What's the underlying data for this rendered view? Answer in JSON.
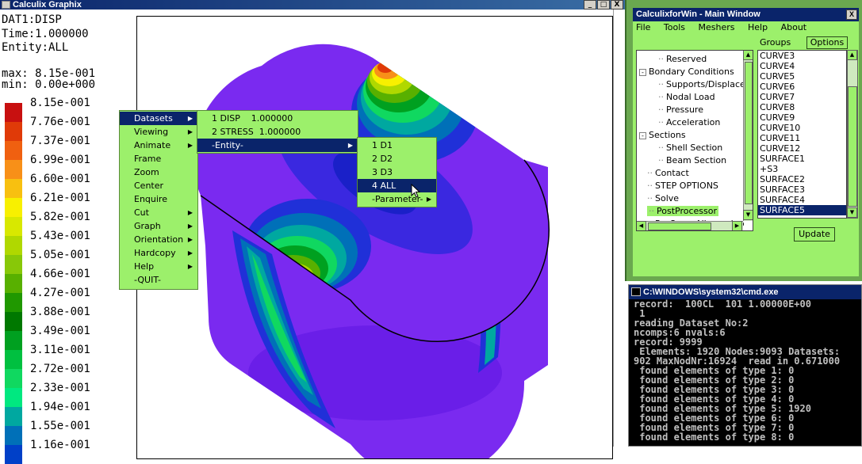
{
  "graphix": {
    "title": "Calculix Graphix",
    "window_buttons": [
      "_",
      "□",
      "X"
    ],
    "info_lines": [
      "DAT1:DISP",
      "Time:1.000000",
      "Entity:ALL"
    ],
    "max_label": "max: 8.15e-001",
    "min_label": "min: 0.00e+000",
    "legend": [
      {
        "label": "8.15e-001",
        "color": "#c81010"
      },
      {
        "label": "7.76e-001",
        "color": "#e03a08"
      },
      {
        "label": "7.37e-001",
        "color": "#f06010"
      },
      {
        "label": "6.99e-001",
        "color": "#f89018"
      },
      {
        "label": "6.60e-001",
        "color": "#f8c010"
      },
      {
        "label": "6.21e-001",
        "color": "#f8f000"
      },
      {
        "label": "5.82e-001",
        "color": "#d8e800"
      },
      {
        "label": "5.43e-001",
        "color": "#b0d800"
      },
      {
        "label": "5.05e-001",
        "color": "#88c808"
      },
      {
        "label": "4.66e-001",
        "color": "#58b000"
      },
      {
        "label": "4.27e-001",
        "color": "#209800"
      },
      {
        "label": "3.88e-001",
        "color": "#007800"
      },
      {
        "label": "3.49e-001",
        "color": "#00a020"
      },
      {
        "label": "3.11e-001",
        "color": "#00c040"
      },
      {
        "label": "2.72e-001",
        "color": "#10d860"
      },
      {
        "label": "2.33e-001",
        "color": "#00e880"
      },
      {
        "label": "1.94e-001",
        "color": "#00a8a0"
      },
      {
        "label": "1.55e-001",
        "color": "#0070b8"
      },
      {
        "label": "1.16e-001",
        "color": "#0040c8"
      }
    ]
  },
  "menus": {
    "main": [
      {
        "label": "Datasets",
        "submenu": true,
        "selected": true
      },
      {
        "label": "Viewing",
        "submenu": true
      },
      {
        "label": "Animate",
        "submenu": true
      },
      {
        "label": "Frame"
      },
      {
        "label": "Zoom"
      },
      {
        "label": "Center"
      },
      {
        "label": "Enquire"
      },
      {
        "label": "Cut",
        "submenu": true
      },
      {
        "label": "Graph",
        "submenu": true
      },
      {
        "label": "Orientation",
        "submenu": true
      },
      {
        "label": "Hardcopy",
        "submenu": true
      },
      {
        "label": "Help",
        "submenu": true
      },
      {
        "label": "-QUIT-"
      }
    ],
    "datasets": [
      {
        "label": "1 DISP    1.000000"
      },
      {
        "label": "2 STRESS  1.000000"
      },
      {
        "label": "-Entity-",
        "submenu": true,
        "selected": true
      }
    ],
    "entity": [
      {
        "label": "1 D1"
      },
      {
        "label": "2 D2"
      },
      {
        "label": "3 D3"
      },
      {
        "label": "4 ALL",
        "selected": true
      },
      {
        "label": "-Parameter-",
        "submenu": true
      }
    ]
  },
  "cfw": {
    "title": "CalculixforWin - Main Window",
    "close_label": "X",
    "menubar": [
      "File",
      "Tools",
      "Meshers",
      "Help",
      "About"
    ],
    "groups_label": "Groups",
    "options_label": "Options",
    "update_label": "Update",
    "tree": [
      {
        "label": "Reserved",
        "indent": 2
      },
      {
        "label": "Bondary Conditions",
        "indent": 0,
        "expander": "-"
      },
      {
        "label": "Supports/Displaceme",
        "indent": 2
      },
      {
        "label": "Nodal Load",
        "indent": 2
      },
      {
        "label": "Pressure",
        "indent": 2
      },
      {
        "label": "Acceleration",
        "indent": 2
      },
      {
        "label": "Sections",
        "indent": 0,
        "expander": "-"
      },
      {
        "label": "Shell Section",
        "indent": 2
      },
      {
        "label": "Beam Section",
        "indent": 2
      },
      {
        "label": "Contact",
        "indent": 1
      },
      {
        "label": "STEP OPTIONS",
        "indent": 1
      },
      {
        "label": "Solve",
        "indent": 1
      },
      {
        "label": "PostProcessor",
        "indent": 1,
        "highlight": true
      },
      {
        "label": "Re-Open Allnone.inp",
        "indent": 1
      }
    ],
    "groups": [
      "CURVE3",
      "CURVE4",
      "CURVE5",
      "CURVE6",
      "CURVE7",
      "CURVE8",
      "CURVE9",
      "CURVE10",
      "CURVE11",
      "CURVE12",
      "SURFACE1",
      "+S3",
      "SURFACE2",
      "SURFACE3",
      "SURFACE4",
      "SURFACE5"
    ],
    "selected_group": "SURFACE5"
  },
  "cmd": {
    "title": "C:\\WINDOWS\\system32\\cmd.exe",
    "lines": [
      "record:  100CL  101 1.00000E+00",
      " 1",
      "reading Dataset No:2",
      "ncomps:6 nvals:6",
      "record: 9999",
      " Elements: 1920 Nodes:9093 Datasets:",
      "902 MaxNodNr:16924  read in 0.671000",
      " found elements of type 1: 0",
      " found elements of type 2: 0",
      " found elements of type 3: 0",
      " found elements of type 4: 0",
      " found elements of type 5: 1920",
      " found elements of type 6: 0",
      " found elements of type 7: 0",
      " found elements of type 8: 0"
    ]
  }
}
